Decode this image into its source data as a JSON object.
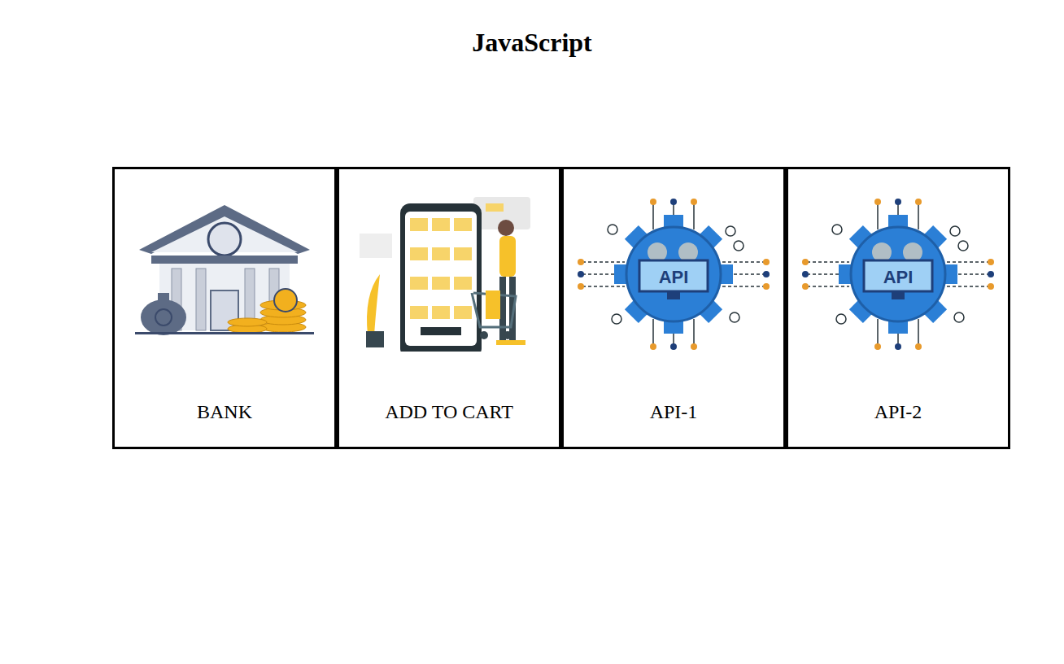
{
  "title": "JavaScript",
  "cards": [
    {
      "label": "BANK",
      "kind": "bank"
    },
    {
      "label": "ADD TO CART",
      "kind": "cart"
    },
    {
      "label": "API-1",
      "kind": "api",
      "badge": "API"
    },
    {
      "label": "API-2",
      "kind": "api",
      "badge": "API"
    }
  ]
}
